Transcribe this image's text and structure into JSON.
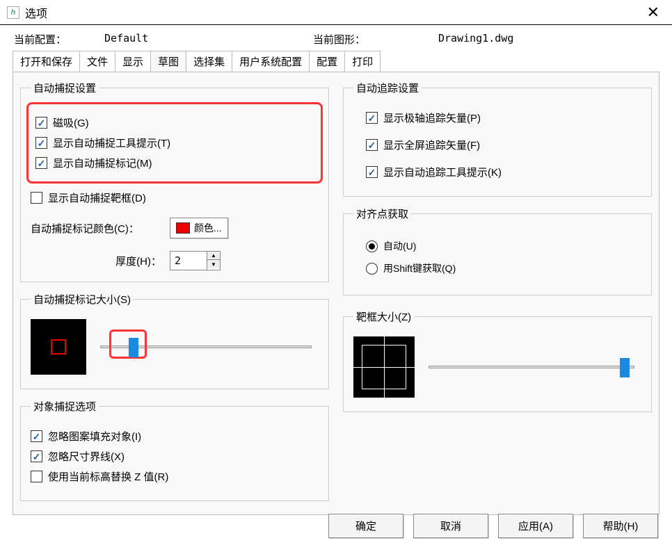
{
  "title": "选项",
  "config": {
    "current_profile_label": "当前配置：",
    "current_profile_value": "Default",
    "current_drawing_label": "当前图形：",
    "current_drawing_value": "Drawing1.dwg"
  },
  "tabs": [
    "打开和保存",
    "文件",
    "显示",
    "草图",
    "选择集",
    "用户系统配置",
    "配置",
    "打印"
  ],
  "active_tab": "草图",
  "autosnap": {
    "legend": "自动捕捉设置",
    "magnet": "磁吸(G)",
    "tooltip": "显示自动捕捉工具提示(T)",
    "marker": "显示自动捕捉标记(M)",
    "aperture": "显示自动捕捉靶框(D)",
    "color_label": "自动捕捉标记颜色(C)：",
    "color_button": "颜色...",
    "thickness_label": "厚度(H)：",
    "thickness_value": "2"
  },
  "autotrack": {
    "legend": "自动追踪设置",
    "polar": "显示极轴追踪矢量(P)",
    "fullscreen": "显示全屏追踪矢量(F)",
    "tooltip": "显示自动追踪工具提示(K)"
  },
  "alignment": {
    "legend": "对齐点获取",
    "auto": "自动(U)",
    "shift": "用Shift键获取(Q)"
  },
  "marker_size": {
    "legend": "自动捕捉标记大小(S)"
  },
  "aperture_size": {
    "legend": "靶框大小(Z)"
  },
  "osnap_options": {
    "legend": "对象捕捉选项",
    "ignore_hatch": "忽略图案填充对象(I)",
    "ignore_dim": "忽略尺寸界线(X)",
    "replace_z": "使用当前标高替换 Z 值(R)"
  },
  "buttons": {
    "ok": "确定",
    "cancel": "取消",
    "apply": "应用(A)",
    "help": "帮助(H)"
  }
}
